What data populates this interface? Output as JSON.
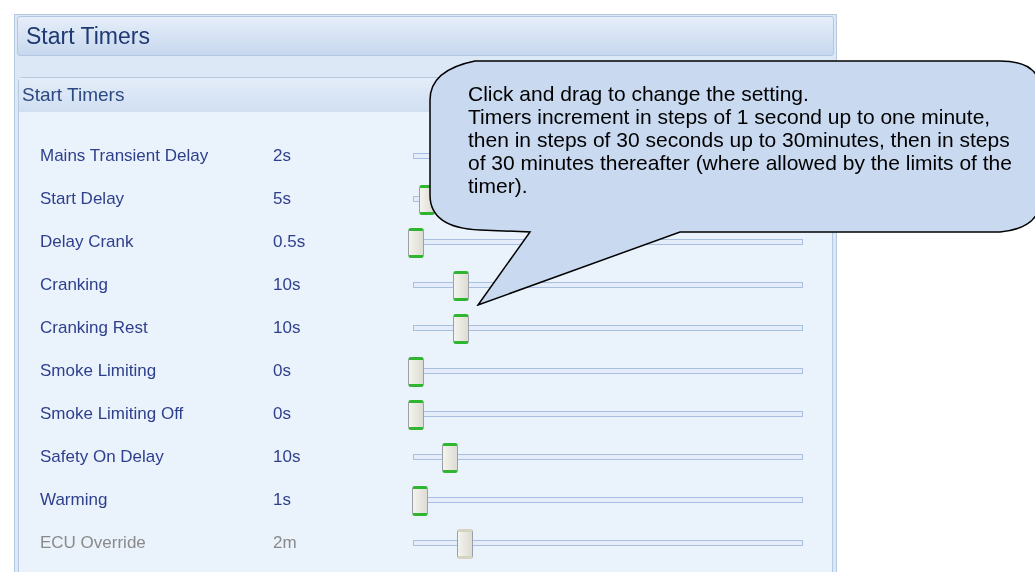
{
  "page_title": "Start Timers",
  "group": {
    "title": "Start Timers",
    "timers": [
      {
        "label": "Mains Transient Delay",
        "value": "2s",
        "disabled": false
      },
      {
        "label": "Start Delay",
        "value": "5s",
        "level": 0.03,
        "disabled": false
      },
      {
        "label": "Delay Crank",
        "value": "0.5s",
        "level": 0,
        "disabled": false
      },
      {
        "label": "Cranking",
        "value": "10s",
        "level": 0.12,
        "disabled": false
      },
      {
        "label": "Cranking Rest",
        "value": "10s",
        "level": 0.12,
        "disabled": false
      },
      {
        "label": "Smoke Limiting",
        "value": "0s",
        "level": 0,
        "disabled": false
      },
      {
        "label": "Smoke Limiting Off",
        "value": "0s",
        "level": 0,
        "disabled": false
      },
      {
        "label": "Safety On Delay",
        "value": "10s",
        "level": 0.09,
        "disabled": false
      },
      {
        "label": "Warming",
        "value": "1s",
        "level": 0.01,
        "disabled": false
      },
      {
        "label": "ECU Override",
        "value": "2m",
        "level": 0.13,
        "disabled": true
      }
    ]
  },
  "callout": {
    "lines": [
      "Click and drag to change the setting.",
      "Timers increment in steps of 1 second up to one minute, then in steps of 30 seconds up to 30minutes, then in steps of 30 minutes thereafter (where allowed by the limits of the timer)."
    ]
  }
}
